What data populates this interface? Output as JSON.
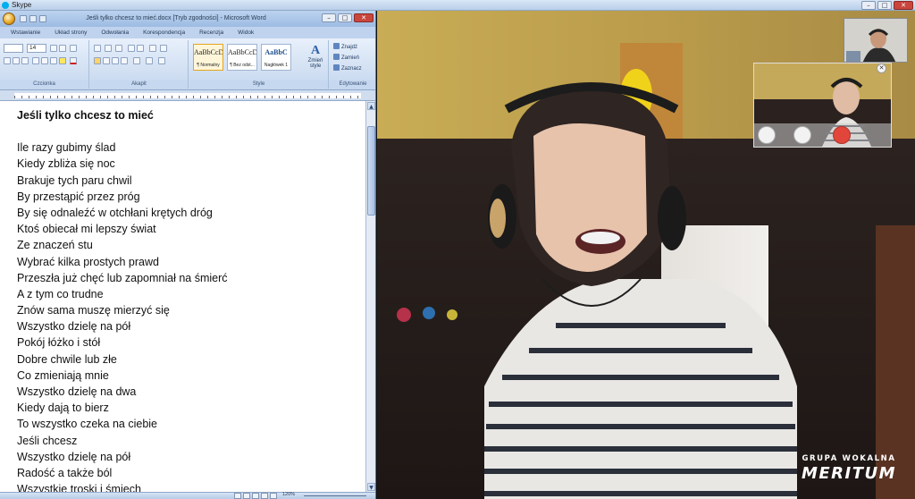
{
  "skype": {
    "window_title": "Skype",
    "window_buttons": [
      "–",
      "□",
      "✕"
    ]
  },
  "word": {
    "title": "Jeśli tylko chcesz to mieć.docx [Tryb zgodności] - Microsoft Word",
    "window_buttons": [
      "–",
      "□",
      "✕"
    ],
    "ribbon_tabs": [
      "Wstawianie",
      "Układ strony",
      "Odwołania",
      "Korespondencja",
      "Recenzja",
      "Widok"
    ],
    "font_size": "14",
    "groups": {
      "font": "Czcionka",
      "paragraph": "Akapit",
      "styles": "Style",
      "editing": "Edytowanie"
    },
    "styles": [
      {
        "sample": "AaBbCcDc",
        "name": "¶ Normalny"
      },
      {
        "sample": "AaBbCcDc",
        "name": "¶ Bez odst..."
      },
      {
        "sample": "AaBbC",
        "name": "Nagłówek 1"
      }
    ],
    "change_styles": "Zmień style",
    "editing_items": [
      "Znajdź",
      "Zamień",
      "Zaznacz"
    ],
    "zoom": "120%"
  },
  "document": {
    "title": "Jeśli tylko chcesz to mieć",
    "lines": [
      "Ile razy gubimy ślad",
      "Kiedy zbliża się noc",
      "Brakuje tych paru chwil",
      "By przestąpić przez próg",
      "By się odnaleźć w otchłani krętych dróg",
      "Ktoś obiecał mi lepszy świat",
      "Ze znaczeń stu",
      "Wybrać kilka prostych prawd",
      "Przeszła już chęć lub zapomniał na śmierć",
      "A z tym co trudne",
      "Znów sama muszę mierzyć się",
      "Wszystko dzielę na pół",
      "Pokój łóżko i stół",
      "Dobre chwile lub złe",
      "Co zmieniają mnie",
      "Wszystko dzielę na dwa",
      "Kiedy dają to bierz",
      "To wszystko czeka na ciebie",
      "Jeśli chcesz",
      "Wszystko dzielę na pół",
      "Radość a także ból",
      "Wszystkie troski i śmiech"
    ]
  },
  "call": {
    "pip_close": "✕"
  },
  "watermark": {
    "top": "GRUPA WOKALNA",
    "main": "MERITUM"
  }
}
